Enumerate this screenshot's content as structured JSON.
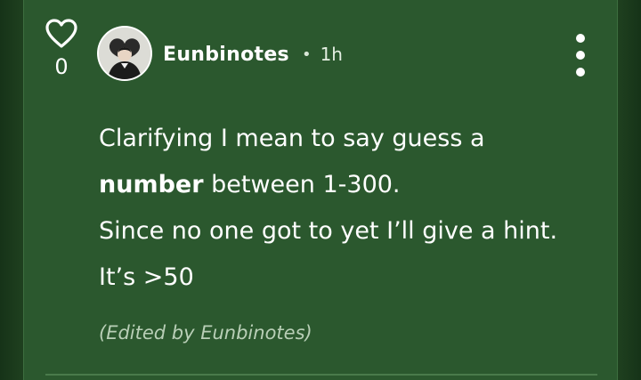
{
  "post": {
    "like_count": "0",
    "author": "Eunbinotes",
    "separator": "•",
    "time": "1h",
    "content": {
      "line1": "Clarifying I mean to say guess a",
      "line2_bold": "number",
      "line2_rest": " between 1-300.",
      "line3": "Since no one got to yet I’ll give a hint.",
      "line4": "It’s >50"
    },
    "edited_note": "(Edited by Eunbinotes)"
  },
  "icons": {
    "like": "heart-icon",
    "more": "more-vertical-icon"
  },
  "colors": {
    "card_background": "#2b582e",
    "page_background": "#1e3d1f",
    "text": "#ffffff",
    "muted_text": "#b9cfb7"
  }
}
